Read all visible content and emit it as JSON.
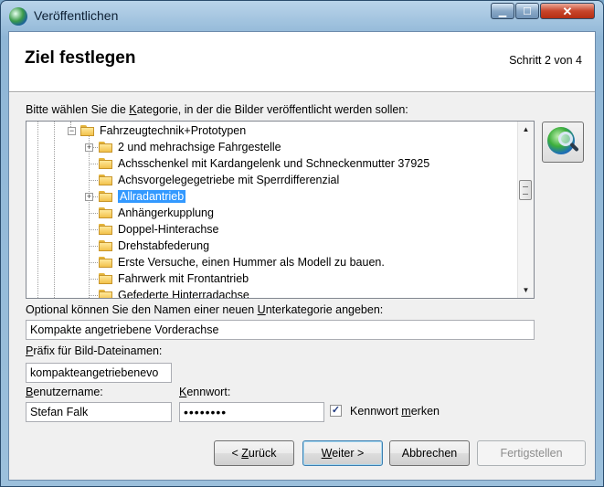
{
  "window": {
    "title": "Veröffentlichen"
  },
  "header": {
    "title": "Ziel festlegen",
    "step": "Schritt 2 von 4"
  },
  "category": {
    "label_pre": "Bitte wählen Sie die ",
    "label_key": "K",
    "label_post": "ategorie, in der die Bilder veröffentlicht werden sollen:",
    "tree": {
      "root": "Fahrzeugtechnik+Prototypen",
      "items": [
        "2 und mehrachsige Fahrgestelle",
        "Achsschenkel mit Kardangelenk und Schneckenmutter 37925",
        "Achsvorgelegegetriebe mit Sperrdifferenzial",
        "Allradantrieb",
        "Anhängerkupplung",
        "Doppel-Hinterachse",
        "Drehstabfederung",
        "Erste Versuche, einen Hummer als Modell zu bauen.",
        "Fahrwerk mit Frontantrieb",
        "Gefederte Hinterradachse"
      ],
      "selected_index": 3
    }
  },
  "subcategory": {
    "label_pre": "Optional können Sie den Namen einer neuen ",
    "label_key": "U",
    "label_post": "nterkategorie angeben:",
    "value": "Kompakte angetriebene Vorderachse"
  },
  "prefix": {
    "label_key": "P",
    "label_post": "räfix für Bild-Dateinamen:",
    "value": "kompakteangetriebenevo"
  },
  "username": {
    "label_key": "B",
    "label_post": "enutzername:",
    "value": "Stefan Falk"
  },
  "password": {
    "label_key": "K",
    "label_post": "ennwort:",
    "value": "••••••••",
    "remember_pre": "Kennwort ",
    "remember_key": "m",
    "remember_post": "erken",
    "remember_checked": "✓"
  },
  "buttons": {
    "back_pre": "< ",
    "back_key": "Z",
    "back_post": "urück",
    "next_key": "W",
    "next_post": "eiter >",
    "cancel": "Abbrechen",
    "finish": "Fertigstellen"
  },
  "colors": {
    "selection": "#3399ff",
    "window_frame": "#8fb6d6"
  },
  "icons": {
    "search": "globe-search-icon"
  }
}
